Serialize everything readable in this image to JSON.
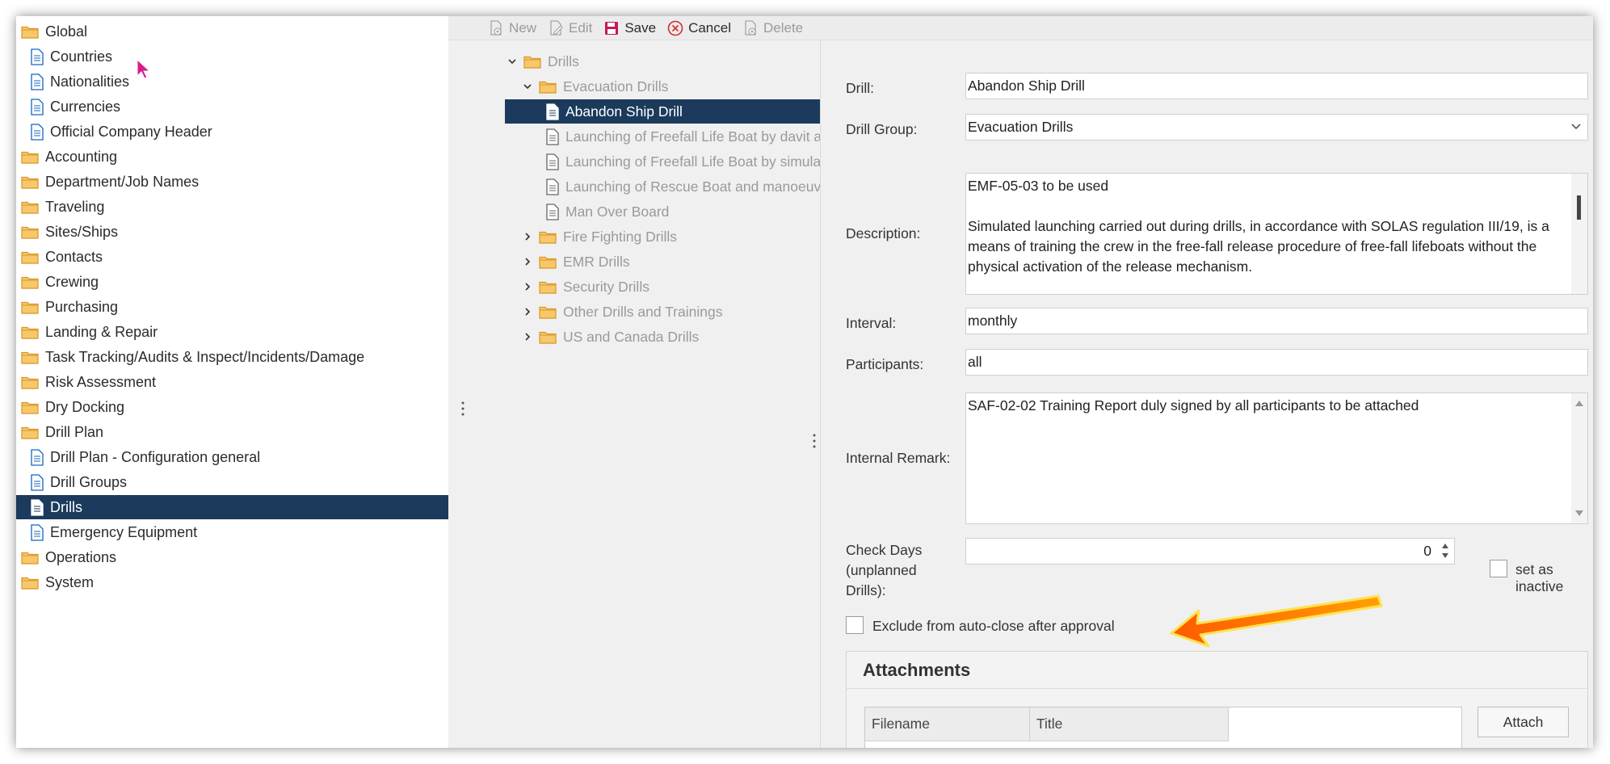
{
  "nav": {
    "items": [
      {
        "type": "folder",
        "label": "Global",
        "name": "nav-global"
      },
      {
        "type": "doc",
        "label": "Countries",
        "name": "nav-countries"
      },
      {
        "type": "doc",
        "label": "Nationalities",
        "name": "nav-nationalities"
      },
      {
        "type": "doc",
        "label": "Currencies",
        "name": "nav-currencies"
      },
      {
        "type": "doc",
        "label": "Official Company Header",
        "name": "nav-official-company-header"
      },
      {
        "type": "folder",
        "label": "Accounting",
        "name": "nav-accounting"
      },
      {
        "type": "folder",
        "label": "Department/Job Names",
        "name": "nav-department-job-names"
      },
      {
        "type": "folder",
        "label": "Traveling",
        "name": "nav-traveling"
      },
      {
        "type": "folder",
        "label": "Sites/Ships",
        "name": "nav-sites-ships"
      },
      {
        "type": "folder",
        "label": "Contacts",
        "name": "nav-contacts"
      },
      {
        "type": "folder",
        "label": "Crewing",
        "name": "nav-crewing"
      },
      {
        "type": "folder",
        "label": "Purchasing",
        "name": "nav-purchasing"
      },
      {
        "type": "folder",
        "label": "Landing & Repair",
        "name": "nav-landing-repair"
      },
      {
        "type": "folder",
        "label": "Task Tracking/Audits & Inspect/Incidents/Damage",
        "name": "nav-task-tracking"
      },
      {
        "type": "folder",
        "label": "Risk Assessment",
        "name": "nav-risk-assessment"
      },
      {
        "type": "folder",
        "label": "Dry Docking",
        "name": "nav-dry-docking"
      },
      {
        "type": "folder",
        "label": "Drill Plan",
        "name": "nav-drill-plan"
      },
      {
        "type": "doc",
        "label": "Drill Plan - Configuration general",
        "name": "nav-drill-plan-config"
      },
      {
        "type": "doc",
        "label": "Drill Groups",
        "name": "nav-drill-groups"
      },
      {
        "type": "doc",
        "label": "Drills",
        "name": "nav-drills",
        "selected": true
      },
      {
        "type": "doc",
        "label": "Emergency Equipment",
        "name": "nav-emergency-equipment"
      },
      {
        "type": "folder",
        "label": "Operations",
        "name": "nav-operations"
      },
      {
        "type": "folder",
        "label": "System",
        "name": "nav-system"
      }
    ]
  },
  "toolbar": {
    "new_label": "New",
    "edit_label": "Edit",
    "save_label": "Save",
    "cancel_label": "Cancel",
    "delete_label": "Delete"
  },
  "tree": {
    "root": "Drills",
    "group": "Evacuation Drills",
    "children": [
      "Abandon Ship Drill",
      "Launching of Freefall Life Boat by davit a",
      "Launching of Freefall Life Boat by simula",
      "Launching of Rescue Boat and manoeuv",
      "Man Over Board"
    ],
    "groups": [
      "Fire Fighting Drills",
      "EMR Drills",
      "Security Drills",
      "Other Drills and Trainings",
      "US and Canada Drills"
    ]
  },
  "form": {
    "drill_label": "Drill:",
    "drill_value": "Abandon Ship Drill",
    "group_label": "Drill Group:",
    "group_value": "Evacuation Drills",
    "description_label": "Description:",
    "description_line1": "EMF-05-03 to be used",
    "description_line2": "Simulated launching carried out during drills, in accordance with SOLAS regulation III/19, is a means of training the crew in the free-fall release procedure of free-fall lifeboats without the physical activation of the release mechanism.",
    "interval_label": "Interval:",
    "interval_value": "monthly",
    "participants_label": "Participants:",
    "participants_value": "all",
    "remark_label": "Internal Remark:",
    "remark_value": "SAF-02-02 Training Report duly signed by all participants to be attached",
    "check_days_label_1": "Check Days",
    "check_days_label_2": "(unplanned",
    "check_days_label_3": "Drills):",
    "check_days_value": "0",
    "inactive_label": "set as inactive",
    "exclude_label": "Exclude from auto-close after approval"
  },
  "attachments": {
    "title": "Attachments",
    "col_filename": "Filename",
    "col_title": "Title",
    "attach_button": "Attach"
  },
  "colors": {
    "selection": "#1b3a5c",
    "folder": "#f7c86a",
    "arrow": "#ff8a00"
  }
}
